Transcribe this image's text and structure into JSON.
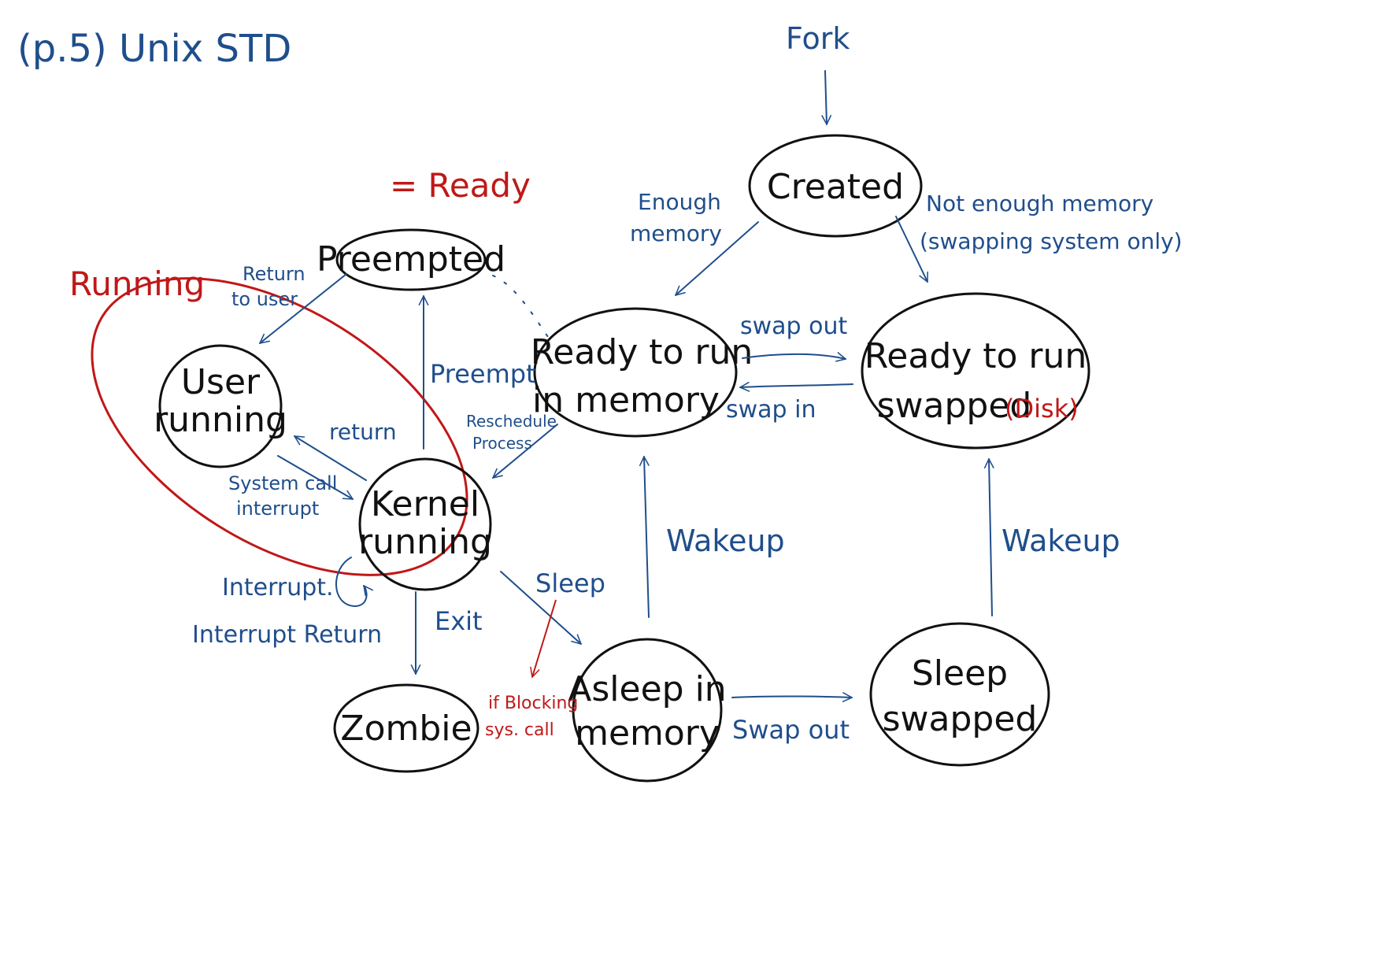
{
  "title": "(p.5) Unix STD",
  "nodes": {
    "user_running": [
      "User",
      "running"
    ],
    "kernel_running": [
      "Kernel",
      "running"
    ],
    "preempted": "Preempted",
    "zombie": "Zombie",
    "created": "Created",
    "ready_in_memory": [
      "Ready to run",
      "in memory"
    ],
    "ready_swapped": [
      "Ready to run",
      "swapped"
    ],
    "ready_swapped_note": "(Disk)",
    "asleep_in_memory": [
      "Asleep in",
      "memory"
    ],
    "sleep_swapped": [
      "Sleep",
      "swapped"
    ]
  },
  "group_labels": {
    "running": "Running",
    "ready": "= Ready"
  },
  "edge_labels": {
    "fork": "Fork",
    "return_to_user": [
      "Return",
      "to user"
    ],
    "return": "return",
    "system_call_interrupt": [
      "System call",
      "interrupt"
    ],
    "preempt": "Preempt",
    "reschedule_process": [
      "Reschedule",
      "Process"
    ],
    "interrupt": "Interrupt.",
    "interrupt_return": "Interrupt Return",
    "exit": "Exit",
    "sleep": "Sleep",
    "if_blocking": [
      "if Blocking",
      "sys. call"
    ],
    "enough_memory": [
      "Enough",
      "memory"
    ],
    "not_enough_memory": [
      "Not enough memory",
      "(swapping system only)"
    ],
    "swap_out_top": "swap out",
    "swap_in": "swap in",
    "wakeup_left": "Wakeup",
    "wakeup_right": "Wakeup",
    "swap_out_bottom": "Swap out"
  },
  "colors": {
    "ink_blue": "#1f4e8c",
    "ink_red": "#c01818",
    "ink_black": "#111111"
  }
}
